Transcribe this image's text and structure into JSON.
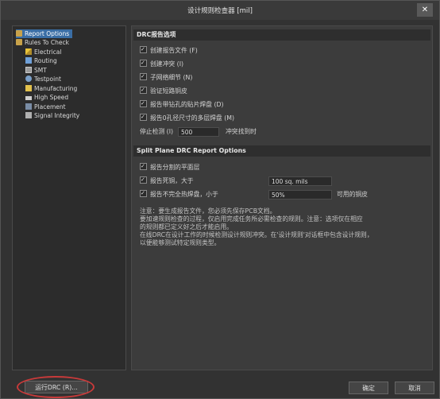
{
  "window": {
    "title": "设计规则检查器 [mil]",
    "close": "✕"
  },
  "tree": {
    "items": [
      {
        "label": "Report Options",
        "icon": "folder-icon"
      },
      {
        "label": "Rules To Check",
        "icon": "folder-icon"
      },
      {
        "label": "Electrical",
        "icon": "electrical-icon"
      },
      {
        "label": "Routing",
        "icon": "routing-icon"
      },
      {
        "label": "SMT",
        "icon": "smt-icon"
      },
      {
        "label": "Testpoint",
        "icon": "testpoint-icon"
      },
      {
        "label": "Manufacturing",
        "icon": "manufacturing-icon"
      },
      {
        "label": "High Speed",
        "icon": "high-speed-icon"
      },
      {
        "label": "Placement",
        "icon": "placement-icon"
      },
      {
        "label": "Signal Integrity",
        "icon": "signal-integrity-icon"
      }
    ]
  },
  "drc": {
    "header": "DRC报告选项",
    "opt1": "创建报告文件 (F)",
    "opt2": "创建冲突 (I)",
    "opt3": "子网络细节 (N)",
    "opt4": "验证短路铜皮",
    "opt5": "报告带钻孔的贴片焊盘 (D)",
    "opt6": "报告0孔径尺寸的多层焊盘 (M)",
    "stop_label": "停止检测 (I)",
    "stop_value": "500",
    "stop_suffix": "冲突找到时"
  },
  "split": {
    "header": "Split Plane DRC Report Options",
    "opt1": "报告分割的平面层",
    "opt2": "报告死铜，大于",
    "opt2_value": "100 sq. mils",
    "opt3": "报告不完全热焊盘，小于",
    "opt3_value": "50%",
    "opt3_suffix": "可用的铜皮"
  },
  "notes": {
    "line1": "注意：要生成报告文件，您必须先保存PCB文档。",
    "line2": "要加速规则检查的过程，仅启用完成任务所必需检查的规则。注意：选项仅在相应",
    "line3": "的规则都已定义好之后才能启用。",
    "line4": "在线DRC在设计工作的时候检测设计规则冲突。在'设计规则'对话框中包含设计规则，",
    "line5": "以便能够测试特定规则类型。"
  },
  "buttons": {
    "run": "运行DRC (R)...",
    "ok": "确定",
    "cancel": "取消"
  }
}
